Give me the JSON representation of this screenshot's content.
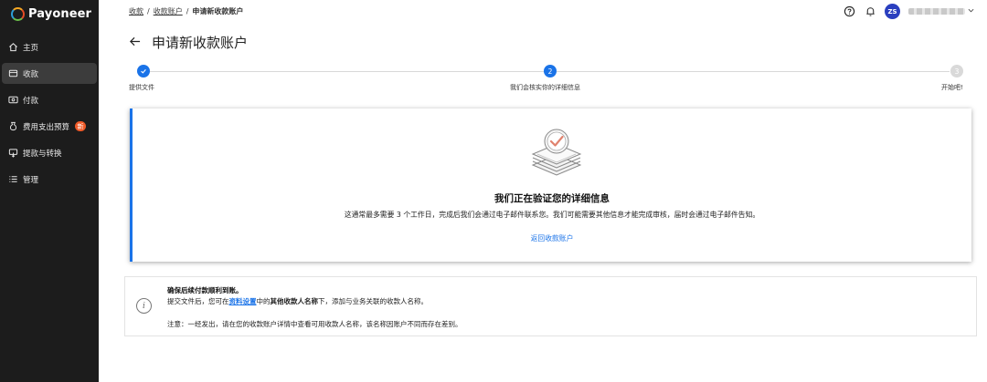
{
  "brand": {
    "name": "Payoneer"
  },
  "sidebar": {
    "items": [
      {
        "label": "主页",
        "icon": "home-icon",
        "active": false
      },
      {
        "label": "收款",
        "icon": "receive-icon",
        "active": true
      },
      {
        "label": "付款",
        "icon": "pay-icon",
        "active": false
      },
      {
        "label": "费用支出预算",
        "icon": "budget-icon",
        "active": false,
        "badge": "新"
      },
      {
        "label": "提款与转换",
        "icon": "withdraw-icon",
        "active": false
      },
      {
        "label": "管理",
        "icon": "manage-icon",
        "active": false
      }
    ]
  },
  "breadcrumb": {
    "items": [
      "收款",
      "收款账户"
    ],
    "separator": "/",
    "current": "申请新收款账户"
  },
  "header": {
    "user_initials": "ZS",
    "help_icon": "help-circle-icon",
    "bell_icon": "bell-icon"
  },
  "page": {
    "title": "申请新收款账户"
  },
  "stepper": {
    "steps": [
      {
        "label": "提供文件",
        "state": "done",
        "number": "1"
      },
      {
        "label": "我们会核实你的详细信息",
        "state": "current",
        "number": "2"
      },
      {
        "label": "开始吧!",
        "state": "todo",
        "number": "3"
      }
    ]
  },
  "card": {
    "title": "我们正在验证您的详细信息",
    "description": "这通常最多需要 3 个工作日，完成后我们会通过电子邮件联系您。我们可能需要其他信息才能完成审核，届时会通过电子邮件告知。",
    "link": "返回收款账户"
  },
  "info": {
    "title": "确保后续付款顺利到账。",
    "line1_before": "提交文件后，您可在",
    "line1_link": "资料设置",
    "line1_middle": "中的",
    "line1_bold": "其他收款人名称",
    "line1_after": "下，添加与业务关联的收款人名称。",
    "line2": "注意：一经发出，请在您的收款账户详情中查看可用收款人名称，该名称因账户不同而存在差别。"
  },
  "colors": {
    "sidebar_bg": "#1c1c1c",
    "accent": "#1a73e8",
    "badge": "#f05a28",
    "avatar": "#2a3fbf"
  }
}
